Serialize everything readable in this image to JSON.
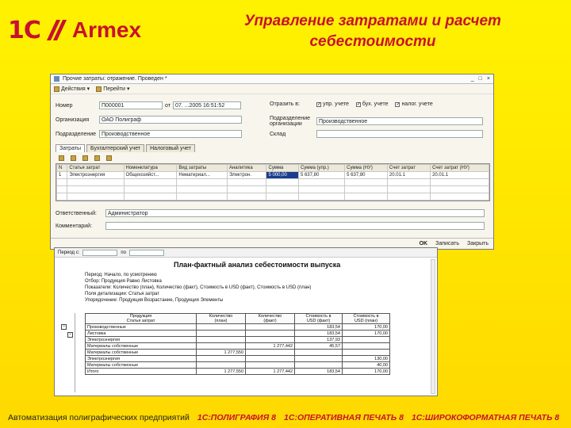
{
  "header": {
    "logo_1c": "1С",
    "logo_armex": "Armex",
    "title_line1": "Управление затратами и расчет",
    "title_line2": "себестоимости"
  },
  "doc_window": {
    "title": "Прочие затраты: отражение. Проведен *",
    "toolbar": [
      "Действия",
      "Перейти"
    ],
    "controls": [
      "_",
      "□",
      "×"
    ],
    "number_label": "Номер",
    "number_value": "П000001",
    "date_label": "от",
    "date_value": "07. ...2005 16:51:52",
    "org_label": "Организация",
    "org_value": "ОАО Полиграф",
    "dept_label": "Подразделение",
    "dept_value": "Производственное",
    "reflect_label": "Отразить в:",
    "checks": [
      "упр. учете",
      "бух. учете",
      "налог. учете"
    ],
    "dept_org_label": "Подразделение организации",
    "dept_org_value": "Производственное",
    "warehouse_label": "Склад",
    "tabs": [
      "Затраты",
      "Бухгалтерский учет",
      "Налоговый учет"
    ],
    "grid_headers": [
      "N",
      "Статья затрат",
      "Номенклатура",
      "Вид затраты",
      "Аналитика",
      "Сумма",
      "Сумма (упр.)",
      "Сумма (НУ)",
      "Счет затрат",
      "Счет затрат (НУ)"
    ],
    "grid_rows": [
      [
        "1",
        "Электроэнергия",
        "Общехозяйст...",
        "Нематериал...",
        "Электрон.",
        "5 000,00",
        "5 637,80",
        "5 637,80",
        "20.01.1",
        "20.01.1"
      ]
    ],
    "responsible_label": "Ответственный:",
    "responsible_value": "Администратор",
    "comment_label": "Комментарий:",
    "buttons": {
      "ok": "OK",
      "save": "Записать",
      "close": "Закрыть"
    }
  },
  "report_window": {
    "period_label": "Период с:",
    "period_to": "по",
    "title": "План-фактный анализ себестоимости выпуска",
    "lines": [
      "Период: Начало, по усмотрению",
      "Отбор: Продукция Равно Листовка",
      "Показатели: Количество (план), Количество (факт), Стоимость в USD (факт), Стоимость в USD (план)",
      "Поля детализации: Статья затрат",
      "Упорядочение: Продукция Возрастание, Продукция Элементы"
    ],
    "table_headers": [
      "Продукция\nСтатья затрат",
      "Количество\n(план)",
      "Количество\n(факт)",
      "Стоимость в\nUSD (факт)",
      "Стоимость в\nUSD (план)"
    ],
    "table_rows": [
      [
        "Производственные",
        "",
        "",
        "183,54",
        "170,00"
      ],
      [
        "Листовка",
        "",
        "",
        "183,54",
        "170,00"
      ],
      [
        "Электроэнергия",
        "",
        "",
        "137,93",
        ""
      ],
      [
        "Материалы собственные",
        "",
        "1 277,442",
        "45,57",
        ""
      ],
      [
        "Материалы собственные",
        "1 277,550",
        "",
        "",
        ""
      ],
      [
        "Электроэнергия",
        "",
        "",
        "",
        "130,00"
      ],
      [
        "Материалы собственные",
        "",
        "",
        "",
        "40,00"
      ],
      [
        "Итого",
        "1 277,550",
        "1 277,442",
        "183,54",
        "170,00"
      ]
    ]
  },
  "footer": {
    "lead": "Автоматизация полиграфических предприятий",
    "items": [
      "1С:ПОЛИГРАФИЯ 8",
      "1С:ОПЕРАТИВНАЯ ПЕЧАТЬ 8",
      "1С:ШИРОКОФОРМАТНАЯ ПЕЧАТЬ 8"
    ]
  },
  "colors": {
    "brand_red": "#c8102e",
    "background_yellow": "#ffe400",
    "selection_blue": "#1b3d8c"
  }
}
